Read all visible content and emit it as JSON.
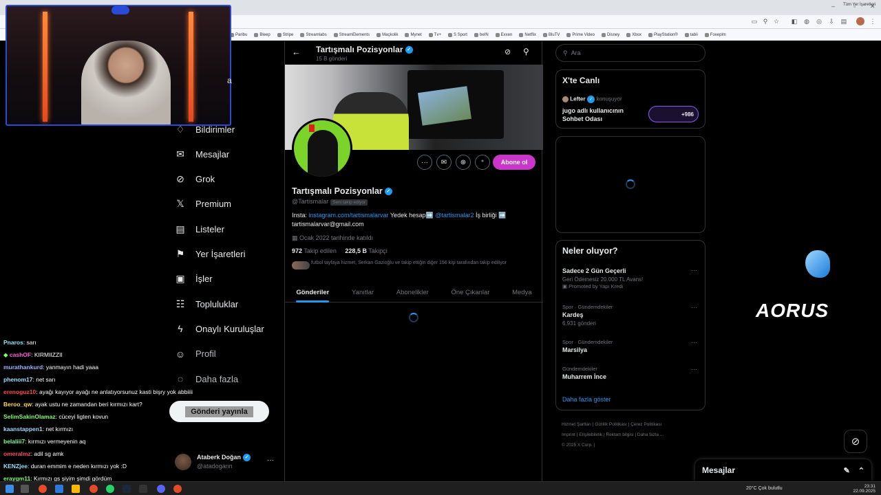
{
  "browser": {
    "bookmarks": [
      "Paribu",
      "Bleep",
      "Stripe",
      "Streamlabs",
      "StreamElements",
      "Maçkolik",
      "Mynet",
      "Tv+",
      "S Sport",
      "beIN",
      "Exxen",
      "Netflix",
      "BluTV",
      "Prime Video",
      "Disney",
      "Xbox",
      "PlayStation®",
      "tabii",
      "Foxeplm"
    ],
    "bookmarks_right": "Tüm Yer İşaretleri"
  },
  "sidebar": {
    "items": [
      {
        "label": "Bildirimler",
        "icon": "bell-icon"
      },
      {
        "label": "Mesajlar",
        "icon": "mail-icon"
      },
      {
        "label": "Grok",
        "icon": "grok-icon"
      },
      {
        "label": "Premium",
        "icon": "x-logo-icon"
      },
      {
        "label": "Listeler",
        "icon": "list-icon"
      },
      {
        "label": "Yer İşaretleri",
        "icon": "bookmark-icon"
      },
      {
        "label": "İşler",
        "icon": "briefcase-icon"
      },
      {
        "label": "Topluluklar",
        "icon": "people-icon"
      },
      {
        "label": "Onaylı Kuruluşlar",
        "icon": "lightning-icon"
      },
      {
        "label": "Profil",
        "icon": "person-icon"
      },
      {
        "label": "Daha fazla",
        "icon": "more-circle-icon"
      }
    ],
    "partial_label": "a",
    "post_button": "Gönderi yayınla",
    "account": {
      "name": "Ataberk Doğan",
      "handle": "@atadogann"
    }
  },
  "chat": [
    {
      "user": "Pnaros",
      "msg": ": sarı",
      "color": "#8fe3ff"
    },
    {
      "user": "cashOF",
      "msg": ": KIRMIIZZII",
      "color": "#ff5fd2",
      "badge": "◆"
    },
    {
      "user": "murathankurd",
      "msg": ": yanmayın hadi yaaa",
      "color": "#9fb5ff"
    },
    {
      "user": "phenom17",
      "msg": ": net sarı",
      "color": "#9fe0ff"
    },
    {
      "user": "erenoguz10",
      "msg": ": ayağı kayıyor ayağı ne anlatıyorsunuz kasti bişry yok abbiiii",
      "color": "#ff4a4a"
    },
    {
      "user": "Beroo_qw",
      "msg": ": ayak ustu ne zamandan beri kırmızı kart?",
      "color": "#ffd94a"
    },
    {
      "user": "SelimSakinOlamaz",
      "msg": ": cüceyi ligten kovun",
      "color": "#7dff6a"
    },
    {
      "user": "kaanstappen1",
      "msg": ": net kırmızı",
      "color": "#9fd8ff"
    },
    {
      "user": "belaliii7",
      "msg": ": kırmızı vermeyenin aq",
      "color": "#7dff9a"
    },
    {
      "user": "omeralmz",
      "msg": ": adil sg amk",
      "color": "#ff4a6a"
    },
    {
      "user": "KENZjee",
      "msg": ": duran emmim e neden kırmızı yok :D",
      "color": "#8fe3ff"
    },
    {
      "user": "eraygm11",
      "msg": ": Kırmızı gs şiyim şimdi gördüm",
      "color": "#7dff6a"
    }
  ],
  "profile": {
    "header_title": "Tartışmalı Pozisyonlar",
    "header_sub": "15 B gönderi",
    "name": "Tartışmalı Pozisyonlar",
    "handle": "@Tartismalar",
    "follows_you": "Seni takip ediyor",
    "subscribe": "Abone ol",
    "bio": {
      "p1": "Insta: ",
      "link1": "instagram.com/tartismalarvar",
      "p2": " Yedek hesap➡️ ",
      "link2": "@tartismalar2",
      "p3": " İş birliği ➡️",
      "p4": "tartismalarvar@gmail.com"
    },
    "joined": "Ocak 2022 tarihinde katıldı",
    "following_count": "972",
    "following_label": " Takip edilen",
    "followers_count": "228,5 B",
    "followers_label": " Takipçi",
    "followed_by": "futbol tayfaya hizmet, Serkan Gazioğlu ve takip ettiğin diğer 156 kişi tarafından takip ediliyor",
    "tabs": [
      "Gönderiler",
      "Yanıtlar",
      "Abonelikler",
      "Öne Çıkanlar",
      "Medya"
    ]
  },
  "right": {
    "search_placeholder": "Ara",
    "live": {
      "title": "X'te Canlı",
      "host": "Lefter",
      "speaking": " konuşuyor",
      "room": "jugo adlı kullanıcının Sohbet Odası",
      "count": "+986"
    },
    "trends": {
      "title": "Neler oluyor?",
      "items": [
        {
          "context": "",
          "name": "Sadece 2 Gün Geçerli",
          "sub": "Geri Ödemesiz 20.000 TL Avans!",
          "promo": "Promoted by Yapı Kredi"
        },
        {
          "context": "Spor · Gündemdekiler",
          "name": "Kardeş",
          "sub": "6.931 gönderi",
          "promo": ""
        },
        {
          "context": "Spor · Gündemdekiler",
          "name": "Marsilya",
          "sub": "",
          "promo": ""
        },
        {
          "context": "Gündemdekiler",
          "name": "Muharrem İnce",
          "sub": "",
          "promo": ""
        }
      ],
      "show_more": "Daha fazla göster"
    },
    "footer": [
      "Hizmet Şartları",
      "Gizlilik Politikası",
      "Çerez Politikası",
      "Imprint",
      "Erişilebilirlik",
      "Reklam bilgisi",
      "Daha fazla ...",
      "© 2025 X Corp."
    ]
  },
  "messages_bar": "Mesajlar",
  "overlay": {
    "brand": "AORUS"
  },
  "taskbar": {
    "weather": "20°C  Çok bulutlu",
    "time": "23:31",
    "date": "22.09.2025"
  }
}
